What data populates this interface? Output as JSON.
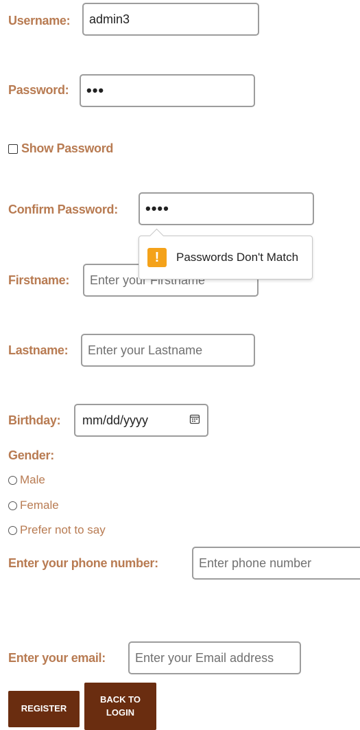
{
  "form": {
    "username": {
      "label": "Username:",
      "value": "admin3"
    },
    "password": {
      "label": "Password:",
      "value": "•••"
    },
    "show_password": {
      "label": "Show Password"
    },
    "confirm_password": {
      "label": "Confirm Password:",
      "value": "••••"
    },
    "validation": {
      "message": "Passwords Don't Match",
      "icon": "warning-icon"
    },
    "firstname": {
      "label": "Firstname:",
      "placeholder": "Enter your Firstname"
    },
    "lastname": {
      "label": "Lastname:",
      "placeholder": "Enter your Lastname"
    },
    "birthday": {
      "label": "Birthday:",
      "placeholder": "mm/dd/yyyy",
      "icon": "calendar-icon"
    },
    "gender": {
      "label": "Gender:",
      "options": [
        "Male",
        "Female",
        "Prefer not to say"
      ]
    },
    "phone": {
      "label": "Enter your phone number:",
      "placeholder": "Enter phone number"
    },
    "email": {
      "label": "Enter your email:",
      "placeholder": "Enter your Email address"
    }
  },
  "buttons": {
    "register": "REGISTER",
    "back_line1": "BACK TO",
    "back_line2": "LOGIN"
  },
  "colors": {
    "label": "#b87b52",
    "button_bg": "#6a2d10",
    "warning": "#f4a21a"
  }
}
